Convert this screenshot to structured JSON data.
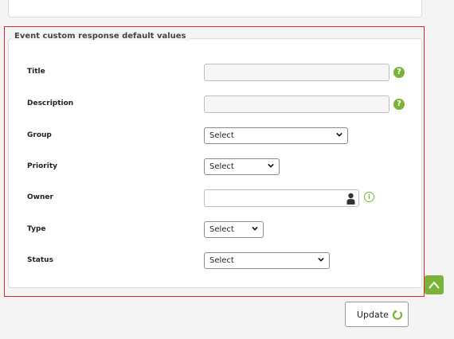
{
  "section": {
    "legend": "Event custom response default values"
  },
  "fields": {
    "title": {
      "label": "Title",
      "value": "",
      "help": "?"
    },
    "description": {
      "label": "Description",
      "value": "",
      "help": "?"
    },
    "group": {
      "label": "Group",
      "selected": "Select"
    },
    "priority": {
      "label": "Priority",
      "selected": "Select"
    },
    "owner": {
      "label": "Owner",
      "value": "",
      "info": "i"
    },
    "type": {
      "label": "Type",
      "selected": "Select"
    },
    "status": {
      "label": "Status",
      "selected": "Select"
    }
  },
  "actions": {
    "update_label": "Update"
  },
  "colors": {
    "accent_green": "#7bb33a",
    "highlight_red": "#d9262b"
  },
  "icons": [
    "help-icon",
    "info-icon",
    "person-icon",
    "chevron-down-icon",
    "refresh-icon",
    "chevron-up-icon"
  ]
}
